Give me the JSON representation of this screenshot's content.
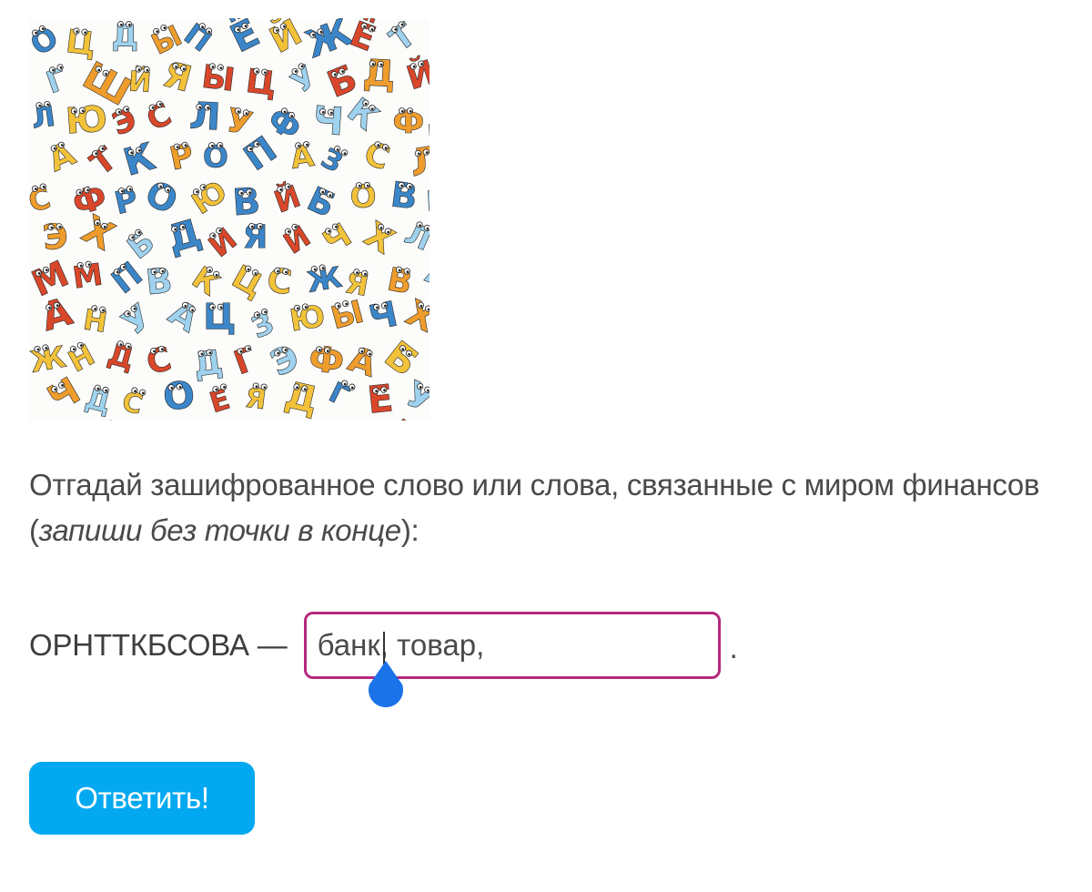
{
  "illustration": {
    "description_icon": "cyrillic-letters-pattern-icon",
    "letters": [
      "А",
      "Б",
      "В",
      "Г",
      "Д",
      "Е",
      "Ё",
      "Ж",
      "З",
      "И",
      "Й",
      "К",
      "Л",
      "М",
      "Н",
      "О",
      "П",
      "Р",
      "С",
      "Т",
      "У",
      "Ф",
      "Х",
      "Ц",
      "Ч",
      "Ш",
      "Э",
      "Ю",
      "Я",
      "Ы"
    ],
    "colors": [
      "#d9472b",
      "#f2c23a",
      "#3b86c9",
      "#9fd2ee",
      "#ee9d2c"
    ]
  },
  "task": {
    "prompt_main": "Отгадай зашифрованное слово или слова, связанные с миром финансов (",
    "prompt_italic": "запиши без точки в конце",
    "prompt_tail": "):",
    "cipher_label": "ОРНТТКБСОВА —",
    "answer_value": "банк, товар,",
    "period": "."
  },
  "actions": {
    "submit_label": "Ответить!"
  },
  "colors": {
    "input_border": "#b5287e",
    "button_bg": "#03a9f0",
    "caret_handle": "#1a73e8"
  }
}
